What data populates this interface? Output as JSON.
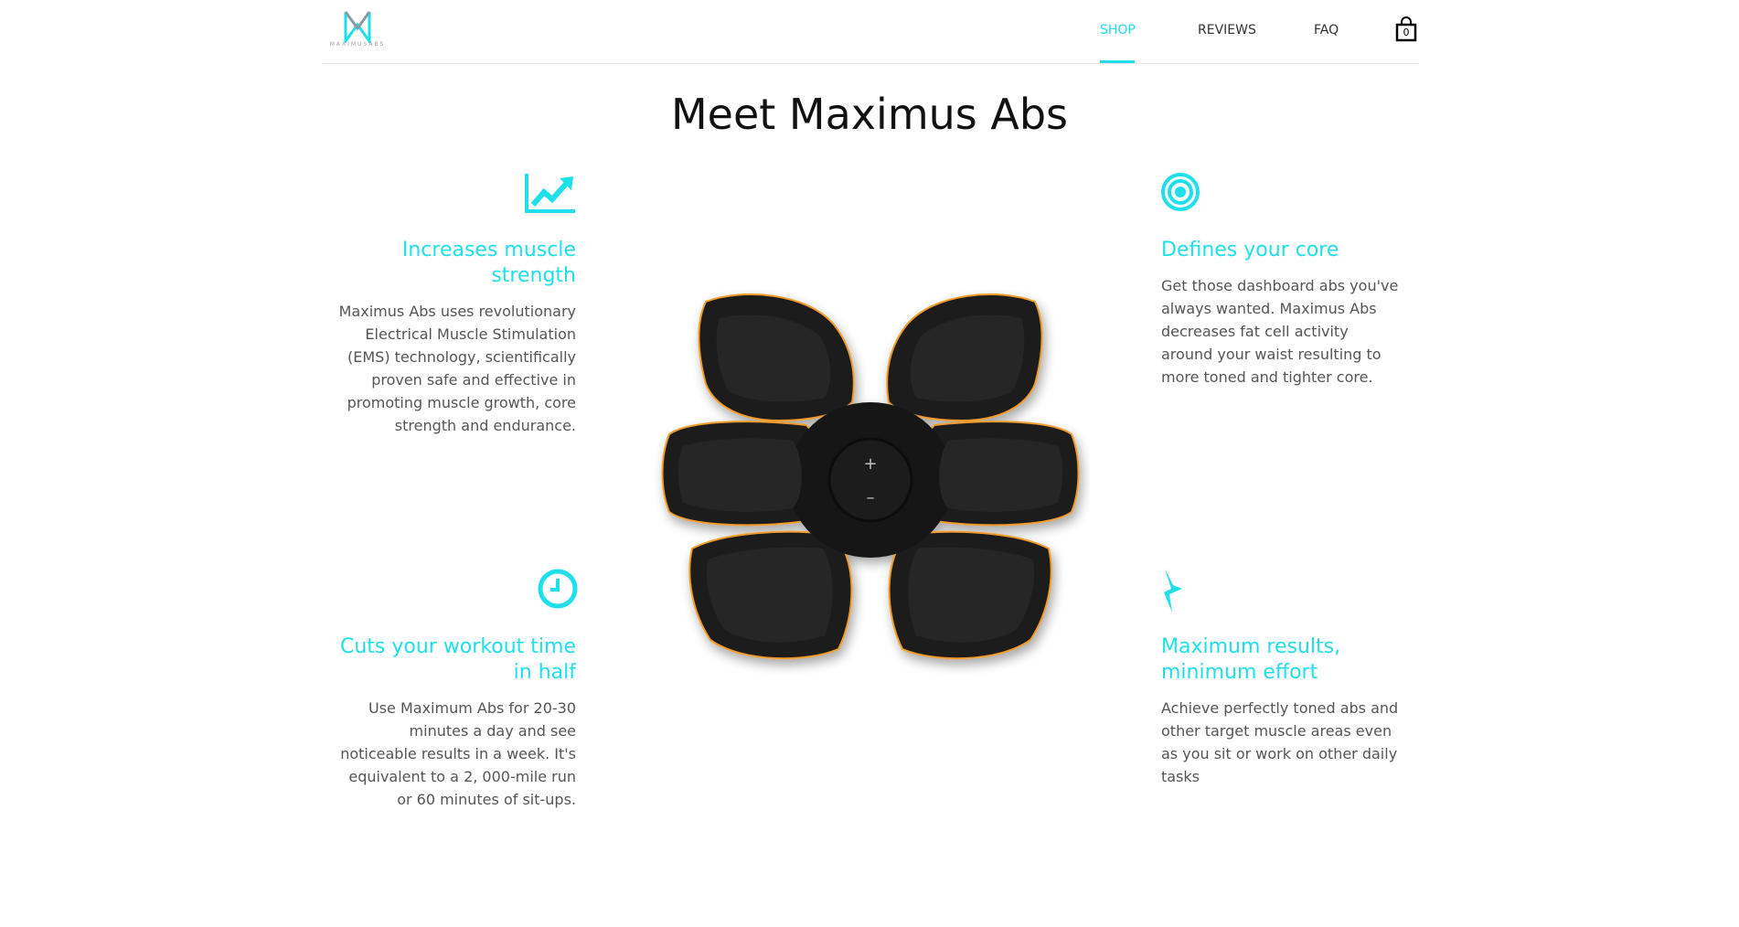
{
  "brand": {
    "logo_text": "MAXIMUSABS"
  },
  "colors": {
    "accent": "#1fe0ea",
    "text": "#555555",
    "title": "#111111"
  },
  "nav": {
    "items": [
      {
        "label": "SHOP",
        "active": true
      },
      {
        "label": "REVIEWS",
        "active": false
      },
      {
        "label": "FAQ",
        "active": false
      }
    ],
    "cart_count": "0",
    "cart_icon": "shopping-bag-icon"
  },
  "page": {
    "title": "Meet Maximus Abs"
  },
  "features": [
    {
      "icon": "trending-up-chart-icon",
      "title": "Increases muscle strength",
      "text": "Maximus Abs uses revolutionary Electrical Muscle Stimulation (EMS) technology, scientifically proven safe and effective in promoting muscle growth, core strength and endurance."
    },
    {
      "icon": "target-icon",
      "title": "Defines your core",
      "text": "Get those dashboard abs you've always wanted. Maximus Abs decreases fat cell activity around your waist resulting to more toned and tighter core."
    },
    {
      "icon": "clock-icon",
      "title": "Cuts your workout time in half",
      "text": "Use Maximum Abs for 20-30 minutes a day and see noticeable results in a week. It's equivalent to a 2, 000-mile run or 60 minutes of sit-ups."
    },
    {
      "icon": "lightning-bolt-icon",
      "title": "Maximum results, minimum effort",
      "text": "Achieve perfectly toned abs and other target muscle areas even as you sit or work on other daily tasks"
    }
  ],
  "product": {
    "button_plus": "+",
    "button_minus": "–"
  }
}
